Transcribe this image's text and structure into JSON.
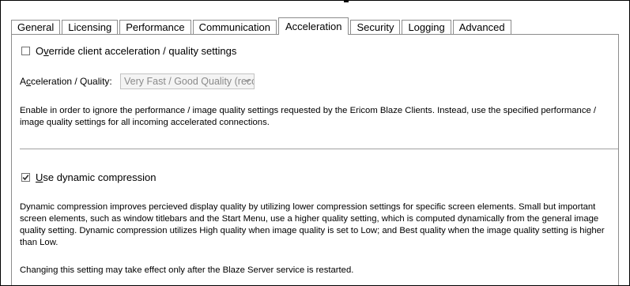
{
  "tabs": [
    {
      "label": "General"
    },
    {
      "label": "Licensing"
    },
    {
      "label": "Performance"
    },
    {
      "label": "Communication"
    },
    {
      "label": "Acceleration"
    },
    {
      "label": "Security"
    },
    {
      "label": "Logging"
    },
    {
      "label": "Advanced"
    }
  ],
  "active_tab": "Acceleration",
  "override": {
    "checked": false,
    "label_pre": "O",
    "label_accel": "v",
    "label_post": "erride client acceleration / quality settings"
  },
  "quality": {
    "label_pre": "A",
    "label_accel": "c",
    "label_post": "celeration / Quality:",
    "value": "Very Fast / Good Quality (recommended)"
  },
  "override_description": "Enable in order to ignore the performance / image quality settings requested by the Ericom Blaze Clients. Instead, use the specified performance / image quality settings for all incoming accelerated connections.",
  "dynamic": {
    "checked": true,
    "label_accel": "U",
    "label_post": "se dynamic compression"
  },
  "dynamic_description": "Dynamic compression improves percieved display quality by utilizing lower compression settings for specific screen elements. Small but important screen elements, such as window titlebars and the Start Menu, use a higher quality setting, which is computed dynamically from the general image quality setting. Dynamic compression utilizes High quality when image quality is set to Low; and Best quality when the image quality setting is higher than Low.",
  "restart_note": "Changing this setting may take effect only after the Blaze Server service is restarted."
}
